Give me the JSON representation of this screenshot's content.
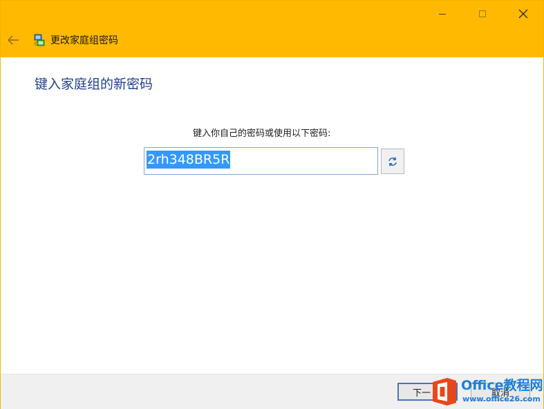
{
  "window": {
    "title": "更改家庭组密码",
    "caption_buttons": [
      "minimize-icon",
      "maximize-icon",
      "close-icon"
    ],
    "titlebar_color": "#ffb900"
  },
  "main": {
    "heading": "键入家庭组的新密码",
    "prompt": "键入你自己的密码或使用以下密码:",
    "password_value": "2rh348BR5R",
    "refresh_icon": "refresh-icon"
  },
  "footer": {
    "next_label": "下一",
    "cancel_label": "取消"
  },
  "watermark": {
    "brand": "Office教程网",
    "url": "www.office26.com"
  }
}
